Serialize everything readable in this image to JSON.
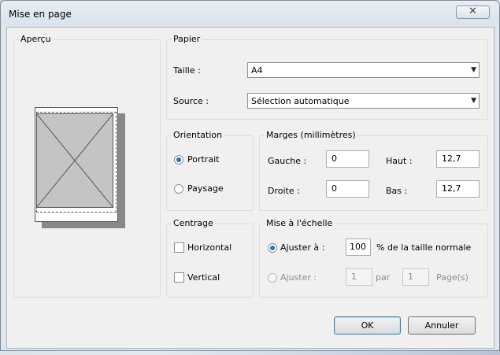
{
  "window": {
    "title": "Mise en page",
    "close_glyph": "✕"
  },
  "preview": {
    "label": "Aperçu"
  },
  "paper": {
    "label": "Papier",
    "size_label": "Taille :",
    "size_value": "A4",
    "source_label": "Source :",
    "source_value": "Sélection automatique"
  },
  "orientation": {
    "label": "Orientation",
    "portrait": "Portrait",
    "landscape": "Paysage",
    "selected": "Portrait"
  },
  "margins": {
    "label": "Marges (millimètres)",
    "left_label": "Gauche :",
    "left_value": "0",
    "top_label": "Haut :",
    "top_value": "12,7",
    "right_label": "Droite :",
    "right_value": "0",
    "bottom_label": "Bas :",
    "bottom_value": "12,7"
  },
  "centering": {
    "label": "Centrage",
    "horizontal": "Horizontal",
    "vertical": "Vertical",
    "horizontal_checked": false,
    "vertical_checked": false
  },
  "scale": {
    "label": "Mise à l'échelle",
    "adjust_to_label": "Ajuster à :",
    "adjust_to_value": "100",
    "adjust_to_suffix": "% de la taille normale",
    "fit_label": "Ajuster :",
    "fit_wide_value": "1",
    "fit_by": "par",
    "fit_tall_value": "1",
    "fit_suffix": "Page(s)",
    "selected": "Ajuster à :"
  },
  "buttons": {
    "ok": "OK",
    "cancel": "Annuler"
  }
}
